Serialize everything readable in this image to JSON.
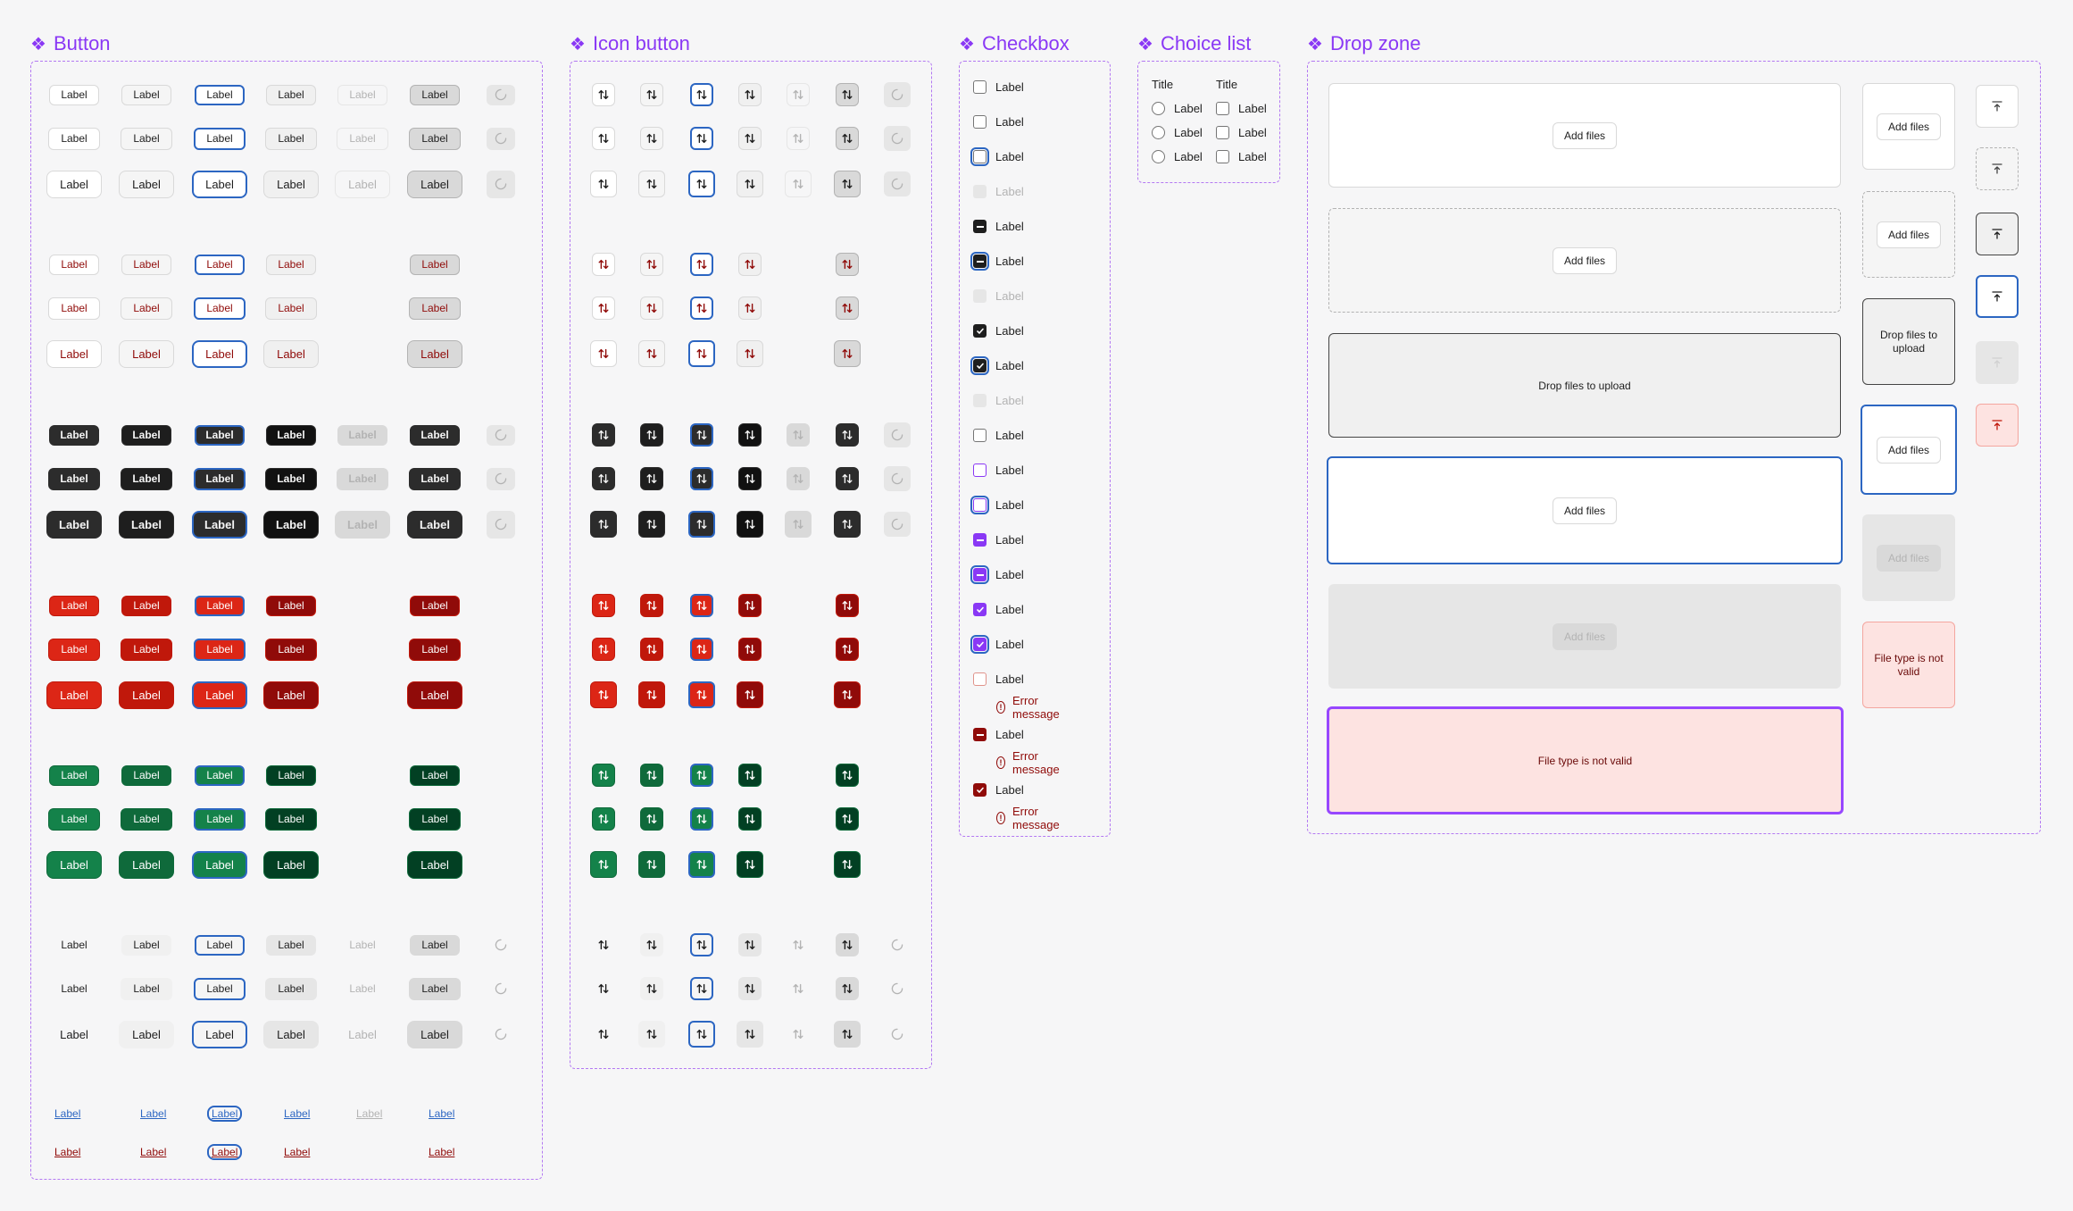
{
  "sections": {
    "button": "Button",
    "icon_button": "Icon button",
    "checkbox": "Checkbox",
    "choice_list": "Choice list",
    "drop_zone": "Drop zone"
  },
  "button": {
    "label": "Label",
    "variants": [
      "neutral",
      "subtle-danger",
      "primary",
      "danger",
      "positive",
      "subtle",
      "link"
    ],
    "states": [
      "default",
      "hover",
      "focus",
      "active",
      "disabled",
      "selected",
      "loading"
    ],
    "sizes": [
      "small",
      "medium",
      "large"
    ]
  },
  "checkbox": {
    "label": "Label",
    "error_message": "Error message",
    "states": [
      "unchecked",
      "unchecked",
      "unchecked-focus",
      "unchecked-disabled",
      "indeterminate",
      "indeterminate-focus",
      "indeterminate-disabled",
      "checked",
      "checked-focus",
      "checked-disabled",
      "unchecked",
      "unchecked-brand",
      "unchecked-brand-focus",
      "indeterminate-brand",
      "indeterminate-brand-focus",
      "checked-brand",
      "checked-brand-focus",
      "error-unchecked",
      "error-indeterminate",
      "error-checked"
    ]
  },
  "choice_list": {
    "radio_title": "Title",
    "checkbox_title": "Title",
    "items": [
      "Label",
      "Label",
      "Label"
    ]
  },
  "drop_zone": {
    "add_files": "Add files",
    "drop_files": "Drop files to upload",
    "invalid": "File type is not valid",
    "states": [
      "default",
      "hover",
      "drag-over",
      "focus",
      "disabled",
      "error"
    ]
  },
  "colors": {
    "accent": "#8a38f5",
    "focus": "#2c66c2",
    "danger": "#dc2616",
    "dark": "#2c2c2c",
    "positive": "#14824a",
    "error_bg": "#fde3e1"
  },
  "icons": [
    "swap-arrows-icon",
    "loading-spinner-icon",
    "upload-icon",
    "error-circle-icon",
    "diamond-component-icon"
  ]
}
